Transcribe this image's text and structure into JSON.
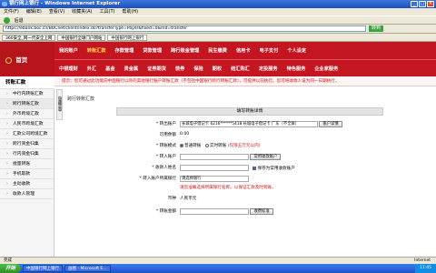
{
  "window": {
    "title": "银行网上银行 - Windows Internet Explorer"
  },
  "menubar": [
    "文件(F)",
    "编辑(E)",
    "查看(V)",
    "收藏夹(A)",
    "工具(T)",
    "帮助(H)"
  ],
  "toolbar": {
    "url": "https://ebank.boc.cn/BOCnet/client/index.do?transferType=Payer&fixed=0&rnd=transfer",
    "go": "转到",
    "back_label": "后退"
  },
  "tabs": [
    "360安全_网一代安全上网",
    "中国银行全球门户网站",
    "中国银行网上银行"
  ],
  "logo": {
    "text": "首页"
  },
  "nav": {
    "row1": [
      "我的账户",
      "转账汇款",
      "存款管理",
      "贷款管理",
      "跨行账金管理",
      "民生缴费",
      "信用卡",
      "电子支付",
      "个人设定"
    ],
    "row2": [
      "中银理财",
      "外汇",
      "基金",
      "贵金属",
      "证券期货",
      "债券",
      "保险",
      "期权",
      "结汇购汇",
      "定投服务",
      "特色服务",
      "企业家服务"
    ]
  },
  "alert": "提示：您可通过此功能向中国银行以外的其他银行账户转账汇款（不包括中国银行跨行转账汇款），可提供以前执行。您可将收款人设为同一日期执行。",
  "sidebar": {
    "title": "转账汇款",
    "items": [
      "中行内转账汇款",
      "跨行转账汇款",
      "外币跨境汇款",
      "人民币跨境汇款",
      "汇款公司跨境汇款",
      "跨行资金归集",
      "行内资金归集",
      "批量转账",
      "手机取款",
      "主动收款",
      "收款人管理"
    ]
  },
  "hide_label": "隐藏菜单",
  "content": {
    "title": "跨行转账汇款",
    "panel_title": "填写转账详情",
    "rows": {
      "payer": {
        "label": "* 转出账户",
        "value": "长城电子借记卡 6216******5418 长城电子借记卡 广东（不全屏）",
        "btn": "账户详情"
      },
      "balance": {
        "label": "可用余额",
        "value": "0.00"
      },
      "mode": {
        "label": "* 转账模式",
        "opt1": "普通转账",
        "opt2": "实时转账",
        "note": "(仅限五万元以内)"
      },
      "payee": {
        "label": "* 转入账户",
        "btn": "常用收款账户"
      },
      "name": {
        "label": "* 收款人姓名",
        "save": "保存为常用收款账户"
      },
      "bank": {
        "label": "* 转入账户所属银行",
        "select": "请选择银行",
        "note": "请您准确选择所属银行名称。以保证汇款及时到账。"
      },
      "currency": {
        "label": "币种",
        "value": "人民币元"
      },
      "amount": {
        "label": "* 转账金额",
        "btn": "收费标准"
      }
    }
  },
  "statusbar": {
    "left": "完成",
    "zone": "Internet"
  },
  "taskbar": {
    "start": "开始",
    "tasks": [
      "中国银行网上银行",
      "画图 - Microsoft E..."
    ],
    "clock": "11:45"
  },
  "colors": {
    "brand": "#c41620",
    "alert": "#d01010"
  }
}
